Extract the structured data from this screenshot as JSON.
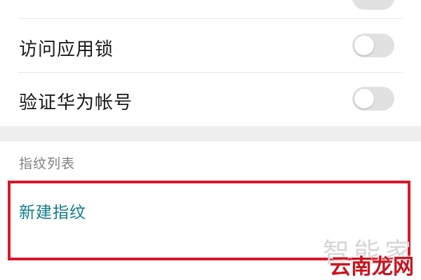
{
  "settings": {
    "rows": [
      {
        "label": "访问应用锁",
        "toggle_on": false
      },
      {
        "label": "验证华为帐号",
        "toggle_on": false
      }
    ]
  },
  "fingerprint_list": {
    "section_title": "指纹列表",
    "new_fingerprint_label": "新建指纹"
  },
  "watermark": {
    "top_text": "智能家",
    "bottom_text": "云南龙网"
  },
  "colors": {
    "accent_link": "#127d87",
    "highlight_border": "#d9182a",
    "toggle_off": "#e1e1e1"
  }
}
